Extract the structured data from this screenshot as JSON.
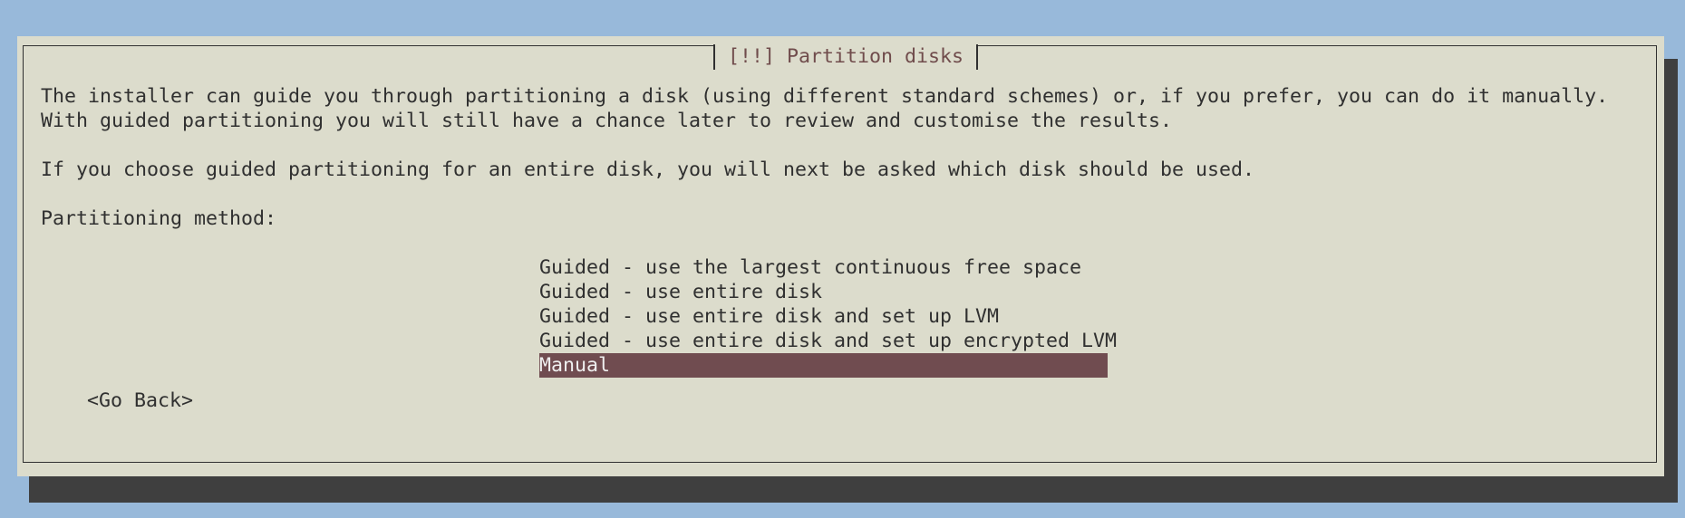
{
  "dialog": {
    "title": "[!!] Partition disks",
    "paragraph1_line1": "The installer can guide you through partitioning a disk (using different standard schemes) or, if you prefer, you can do it manually.",
    "paragraph1_line2": "With guided partitioning you will still have a chance later to review and customise the results.",
    "paragraph2": "If you choose guided partitioning for an entire disk, you will next be asked which disk should be used.",
    "prompt": "Partitioning method:",
    "options": [
      "Guided - use the largest continuous free space",
      "Guided - use entire disk",
      "Guided - use entire disk and set up LVM",
      "Guided - use entire disk and set up encrypted LVM",
      "Manual"
    ],
    "selected_option": "Manual",
    "go_back_label": "<Go Back>"
  },
  "colors": {
    "desktop_background": "#98b9da",
    "dialog_background": "#dcdccc",
    "text": "#303030",
    "title_text": "#704c4c",
    "selection_background": "#704c50",
    "selection_text": "#efefef",
    "shadow": "#3f3f3f"
  }
}
